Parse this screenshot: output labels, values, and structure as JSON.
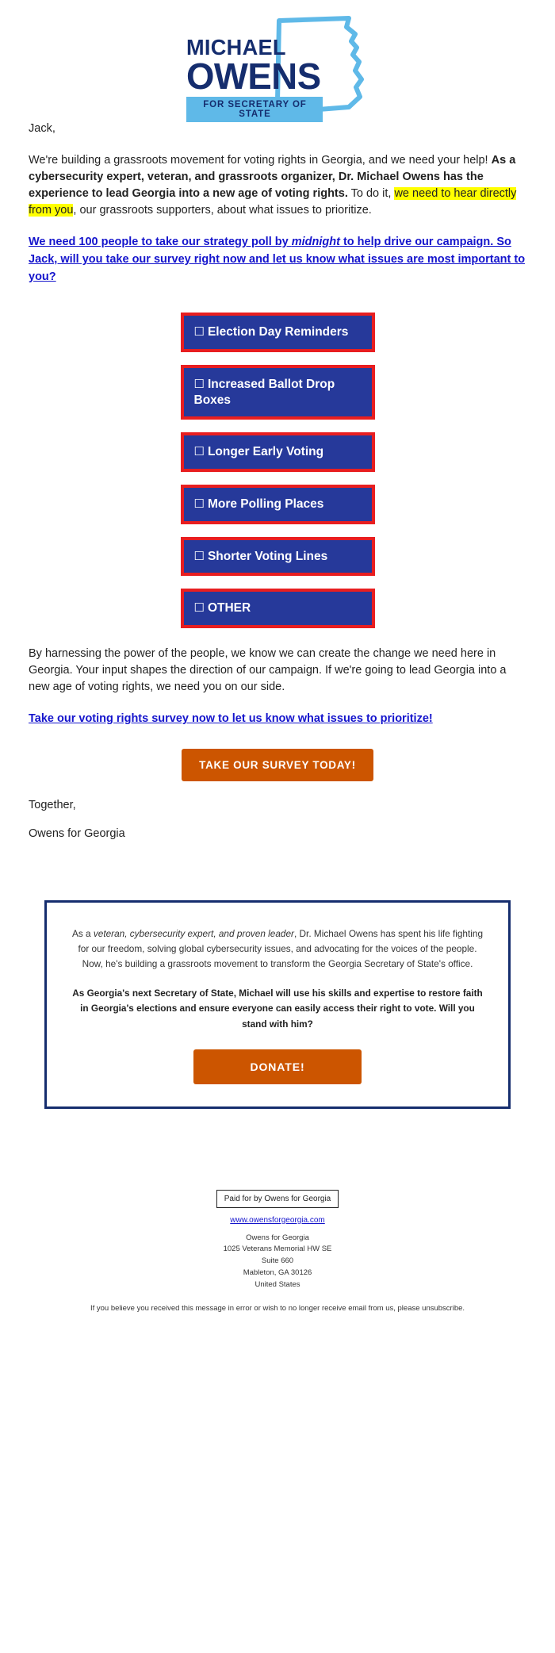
{
  "brand": {
    "navy": "#152d6e",
    "light_blue": "#5fb9e8",
    "button_blue": "#26399a",
    "red": "#e81e20",
    "orange": "#cc5500",
    "link_blue": "#1414cc",
    "highlight_yellow": "#ffff00"
  },
  "logo": {
    "line1": "MICHAEL",
    "line2": "OWENS",
    "banner": "FOR SECRETARY OF STATE",
    "state_outline": "georgia-state-outline"
  },
  "email": {
    "greeting": "Jack,",
    "para1": {
      "seg1": "We're building a grassroots movement for voting rights in Georgia, and we need your help! ",
      "seg2_bold": "As a cybersecurity expert, veteran, and grassroots organizer, Dr. Michael Owens has the experience to lead Georgia into a new age of voting rights.",
      "seg3": " To do it, ",
      "seg4_highlight": "we need to hear directly from you",
      "seg5": ", our grassroots supporters, about what issues to prioritize."
    },
    "link_para": {
      "seg1": "We need 100 people to take our strategy poll by ",
      "seg2_italic": "midnight",
      "seg3": " to help drive our campaign. So Jack, will you take our survey right now and let us know what issues are most important to you?"
    },
    "para2": "By harnessing the power of the people, we know we can create the change we need here in Georgia. Your input shapes the direction of our campaign. If we're going to lead Georgia into a new age of voting rights, we need you on our side.",
    "link_para2": "Take our voting rights survey now to let us know what issues to prioritize!",
    "cta_label": "TAKE OUR SURVEY TODAY!",
    "sign_off_1": "Together,",
    "sign_off_2": "Owens for Georgia"
  },
  "survey": {
    "checkbox_glyph": "☐",
    "options": [
      {
        "label": "Election Day Reminders"
      },
      {
        "label": "Increased Ballot Drop Boxes"
      },
      {
        "label": "Longer Early Voting"
      },
      {
        "label": "More Polling Places"
      },
      {
        "label": "Shorter Voting Lines"
      },
      {
        "label": "OTHER"
      }
    ]
  },
  "donate_box": {
    "para1": {
      "seg1": "As a ",
      "seg2_italic": "veteran, cybersecurity expert, and proven leader",
      "seg3": ", Dr. Michael Owens has spent his life fighting for our freedom, solving global cybersecurity issues, and advocating for the voices of the people. Now, he's building a grassroots movement to transform the Georgia Secretary of State's office."
    },
    "para2_bold": "As Georgia's next Secretary of State, Michael will use his skills and expertise to restore faith in Georgia's elections and ensure everyone can easily access their right to vote. Will you stand with him?",
    "donate_label": "DONATE!"
  },
  "footer": {
    "paid_for": "Paid for by Owens for Georgia",
    "website": "www.owensforgeorgia.com",
    "address": [
      "Owens for Georgia",
      "1025 Veterans Memorial HW SE",
      "Suite 660",
      "Mableton, GA 30126",
      "United States"
    ],
    "unsub_prefix": "If you believe you received this message in error or wish to no longer receive email from us, please ",
    "unsub_link": "unsubscribe",
    "unsub_suffix": "."
  }
}
